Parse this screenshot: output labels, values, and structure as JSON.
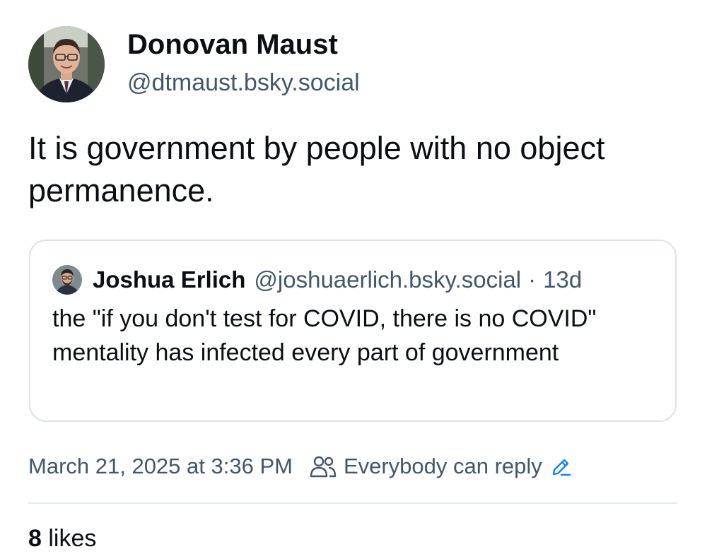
{
  "author": {
    "display_name": "Donovan Maust",
    "handle": "@dtmaust.bsky.social"
  },
  "post": {
    "text": "It is government by people with no object permanence."
  },
  "quoted_post": {
    "display_name": "Joshua Erlich",
    "handle": "@joshuaerlich.bsky.social",
    "separator": "·",
    "age": "13d",
    "text": "the \"if you don't test for COVID, there is no COVID\" mentality has infected every part of government"
  },
  "meta": {
    "timestamp": "March 21, 2025 at 3:36 PM",
    "reply_setting": "Everybody can reply",
    "people_icon": "people-icon",
    "edit_icon": "pencil-icon"
  },
  "stats": {
    "likes_count": "8",
    "likes_label": "likes"
  },
  "colors": {
    "text": "#0b0f14",
    "muted": "#42576c",
    "accent": "#1083fe",
    "border": "#dde3ea"
  }
}
